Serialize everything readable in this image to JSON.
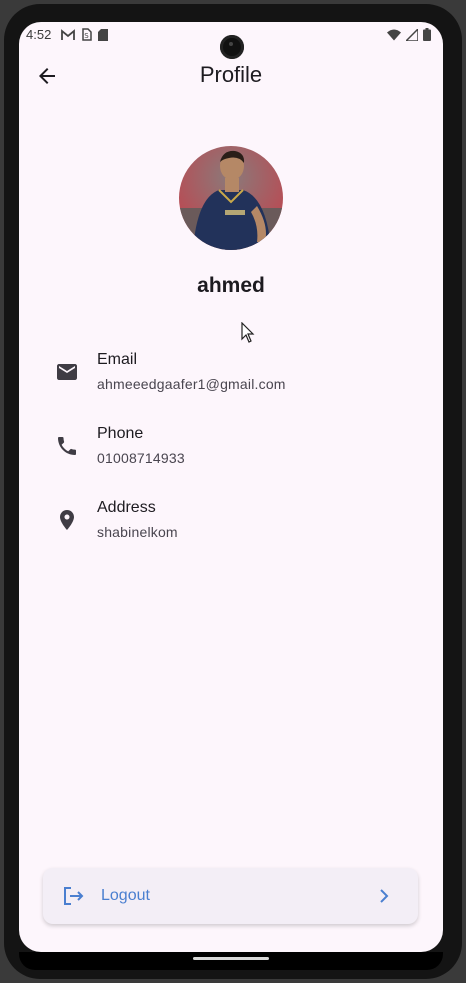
{
  "status_bar": {
    "time": "4:52",
    "left_icons": [
      "gmail-icon",
      "sim-alert-icon",
      "sd-card-icon"
    ],
    "right_icons": [
      "wifi-icon",
      "signal-icon",
      "battery-icon"
    ]
  },
  "app_bar": {
    "title": "Profile",
    "back_icon": "arrow-back-icon"
  },
  "profile": {
    "name": "ahmed",
    "avatar": "profile-photo"
  },
  "info": [
    {
      "label": "Email",
      "value": "ahmeeedgaafer1@gmail.com",
      "icon": "email-icon"
    },
    {
      "label": "Phone",
      "value": "01008714933",
      "icon": "phone-icon"
    },
    {
      "label": "Address",
      "value": "shabinelkom",
      "icon": "location-pin-icon"
    }
  ],
  "logout": {
    "label": "Logout",
    "icon": "logout-icon",
    "chevron": "chevron-right-icon"
  },
  "colors": {
    "background": "#fdf6fc",
    "text_primary": "#1d1b20",
    "accent": "#4a7fd0",
    "card": "#f3eef6"
  }
}
